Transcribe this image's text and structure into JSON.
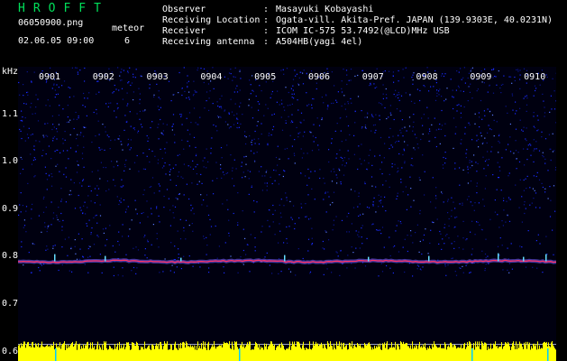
{
  "header": {
    "brand": "HROFFT",
    "filename": "06050900.png",
    "datetime": "02.06.05 09:00",
    "meteor_label": "meteor",
    "meteor_count": "6",
    "rows": [
      {
        "label": "Observer",
        "value": "Masayuki Kobayashi"
      },
      {
        "label": "Receiving Location",
        "value": "Ogata-vill. Akita-Pref. JAPAN (139.9303E, 40.0231N)"
      },
      {
        "label": "Receiver",
        "value": "ICOM IC-575 53.7492(@LCD)MHz USB"
      },
      {
        "label": "Receiving antenna",
        "value": "A504HB(yagi 4el)"
      }
    ]
  },
  "spectrogram": {
    "y_unit": "kHz",
    "y_ticks": [
      "1.1",
      "1.0",
      "0.9",
      "0.8",
      "0.7",
      "0.6"
    ],
    "y_range": [
      0.58,
      1.2
    ],
    "x_ticks": [
      "0901",
      "0902",
      "0903",
      "0904",
      "0905",
      "0906",
      "0907",
      "0908",
      "0909",
      "0910"
    ],
    "carrier_freq": 0.79,
    "colors": {
      "background": "#00003a",
      "noise": "#1a2cff",
      "carrier": "#ff3366",
      "tick": "#ffffff",
      "level_bar": "#ffff00"
    }
  }
}
